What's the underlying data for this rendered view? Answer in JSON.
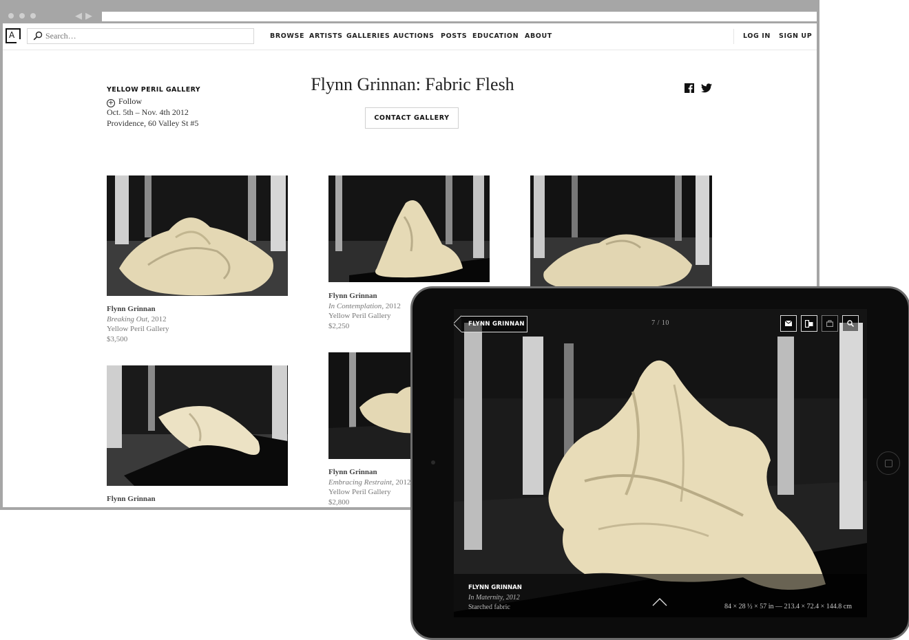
{
  "nav": {
    "search_placeholder": "Search…",
    "links": [
      "BROWSE",
      "ARTISTS",
      "GALLERIES",
      "AUCTIONS",
      "POSTS",
      "EDUCATION",
      "ABOUT"
    ],
    "login": "LOG IN",
    "signup": "SIGN UP"
  },
  "show": {
    "gallery": "YELLOW PERIL GALLERY",
    "follow": "Follow",
    "dates": "Oct. 5th – Nov. 4th 2012",
    "location": "Providence, 60 Valley St #5",
    "title": "Flynn Grinnan: Fabric Flesh",
    "contact": "CONTACT GALLERY"
  },
  "artworks": [
    {
      "artist": "Flynn Grinnan",
      "title": "Breaking Out",
      "year": ", 2012",
      "gallery": "Yellow Peril Gallery",
      "price": "$3,500"
    },
    {
      "artist": "Flynn Grinnan",
      "title": "In Contemplation",
      "year": ", 2012",
      "gallery": "Yellow Peril Gallery",
      "price": "$2,250"
    },
    {
      "artist": "",
      "title": "",
      "year": "",
      "gallery": "",
      "price": ""
    },
    {
      "artist": "Flynn Grinnan",
      "title": "",
      "year": "",
      "gallery": "",
      "price": ""
    },
    {
      "artist": "Flynn Grinnan",
      "title": "Embracing Restraint",
      "year": ", 2012",
      "gallery": "Yellow Peril Gallery",
      "price": "$2,800"
    }
  ],
  "tablet": {
    "back_label": "FLYNN GRINNAN",
    "pager": "7 / 10",
    "toolbar_icons": [
      "mail-icon",
      "share-icon",
      "bag-icon",
      "search-icon"
    ],
    "caption_artist": "FLYNN GRINNAN",
    "caption_title": "In Maternity, 2012",
    "caption_medium": "Starched fabric",
    "dimensions": "84 × 28 ½ × 57 in — 213.4 × 72.4 × 144.8 cm"
  },
  "colors": {
    "frame": "#a6a6a6",
    "tablet": "#0c0c0c",
    "fabric": "#e8dcb8"
  }
}
